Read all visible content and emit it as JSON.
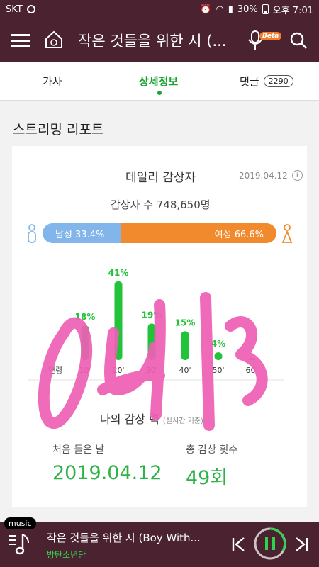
{
  "status_bar": {
    "carrier": "SKT",
    "battery": "30%",
    "time": "오후 7:01"
  },
  "header": {
    "title": "작은 것들을 위한 시 (...",
    "beta_badge": "Beta",
    "icons": [
      "menu-icon",
      "home-icon",
      "mic-icon",
      "search-icon"
    ]
  },
  "tabs": [
    {
      "label": "가사"
    },
    {
      "label": "상세정보",
      "active": true
    },
    {
      "label": "댓글",
      "count": "2290"
    }
  ],
  "section_title": "스트리밍 리포트",
  "daily": {
    "title": "데일리 감상자",
    "date": "2019.04.12",
    "listeners_text": "감상자 수 748,650명",
    "male_label": "남성 33.4%",
    "female_label": "여성 66.6%",
    "male_fraction": 0.334
  },
  "chart_data": {
    "type": "bar",
    "categories": [
      "10'",
      "20'",
      "30'",
      "40'",
      "50'",
      "60'"
    ],
    "values": [
      18,
      41,
      19,
      15,
      4,
      1
    ],
    "value_labels": [
      "18%",
      "41%",
      "19%",
      "15%",
      "4%",
      ""
    ],
    "xlabel": "연령",
    "ylim": [
      0,
      45
    ],
    "color": "#22c23a"
  },
  "my_listening": {
    "title": "나의 감상",
    "title_suffix": "력",
    "subtitle": "(실시간 기준)",
    "first_label": "처음 들은 날",
    "first_value": "2019.04.12",
    "count_label": "총 감상 횟수",
    "count_value": "49회"
  },
  "player": {
    "tag": "music",
    "song": "작은 것들을 위한 시 (Boy With...",
    "artist": "방탄소년단"
  },
  "colors": {
    "header_bg": "#4a2230",
    "accent_green": "#1ca534",
    "male_blue": "#82b6ea",
    "female_orange": "#f08a2c",
    "scribble_pink": "#ee5fb4"
  }
}
